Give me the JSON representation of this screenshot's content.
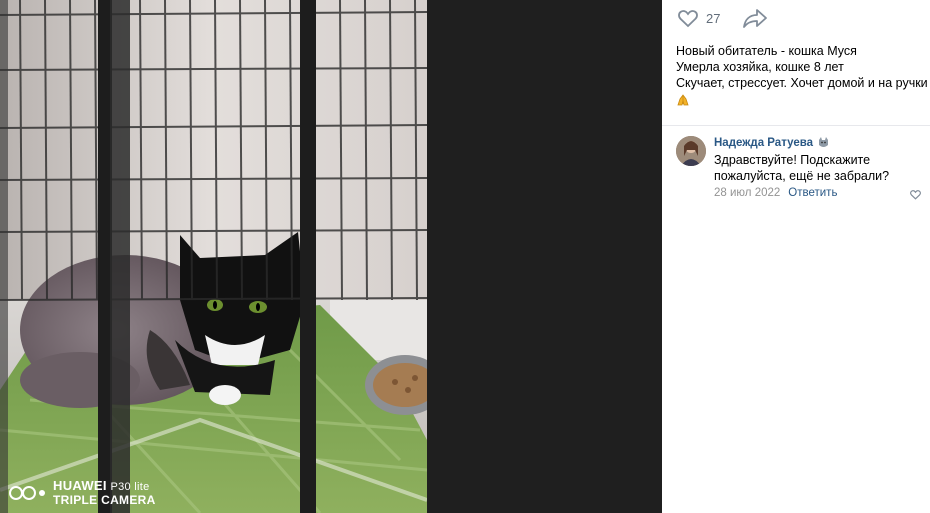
{
  "post": {
    "likes": "27",
    "caption_lines": [
      "Новый обитатель - кошка Муся",
      "Умерла хозяйка, кошке 8 лет",
      "Скучает, стрессует. Хочет домой и на ручки"
    ],
    "caption_emoji": "folded-hands"
  },
  "photo": {
    "watermark_brand": "HUAWEI",
    "watermark_model": "P30 lite",
    "watermark_camera": "TRIPLE CAMERA"
  },
  "comment": {
    "author": "Надежда Ратуева",
    "text": "Здравствуйте! Подскажите пожалуйста, ещё не забрали?",
    "date": "28 июл 2022",
    "reply_label": "Ответить"
  },
  "icons": {
    "like": "heart-icon",
    "share": "share-arrow-icon",
    "comment_like": "heart-icon"
  },
  "colors": {
    "link": "#2a5885",
    "muted": "#939393",
    "counter": "#626d7a",
    "dark_background": "#1f1f1f"
  }
}
